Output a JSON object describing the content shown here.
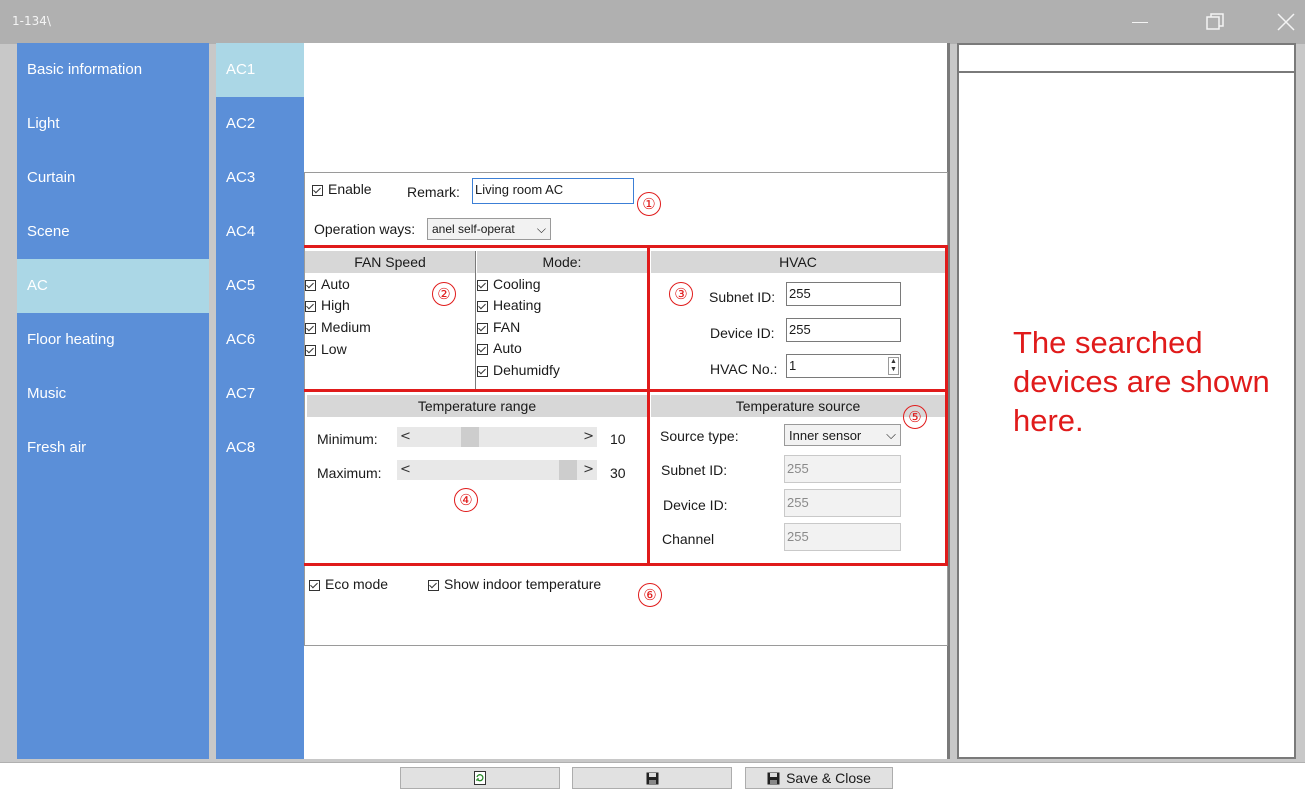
{
  "window": {
    "title": "1-134\\"
  },
  "sidebar": {
    "items": [
      {
        "label": "Basic information"
      },
      {
        "label": "Light"
      },
      {
        "label": "Curtain"
      },
      {
        "label": "Scene"
      },
      {
        "label": "AC",
        "active": true
      },
      {
        "label": "Floor heating"
      },
      {
        "label": "Music"
      },
      {
        "label": "Fresh air"
      }
    ]
  },
  "ac_tabs": [
    "AC1",
    "AC2",
    "AC3",
    "AC4",
    "AC5",
    "AC6",
    "AC7",
    "AC8"
  ],
  "general": {
    "enable_label": "Enable",
    "remark_label": "Remark:",
    "remark_value": "Living room AC",
    "operation_label": "Operation ways:",
    "operation_value": "anel self-operat"
  },
  "fan_speed": {
    "header": "FAN Speed",
    "options": [
      "Auto",
      "High",
      "Medium",
      "Low"
    ]
  },
  "mode": {
    "header": "Mode:",
    "options": [
      "Cooling",
      "Heating",
      "FAN",
      "Auto",
      "Dehumidfy"
    ]
  },
  "hvac": {
    "header": "HVAC",
    "subnet_label": "Subnet ID:",
    "subnet_value": "255",
    "device_label": "Device ID:",
    "device_value": "255",
    "no_label": "HVAC No.:",
    "no_value": "1"
  },
  "temp_range": {
    "header": "Temperature range",
    "min_label": "Minimum:",
    "min_value": "10",
    "min_arrow_left": "<",
    "min_arrow_right": ">",
    "max_label": "Maximum:",
    "max_value": "30",
    "max_arrow_left": "<",
    "max_arrow_right": ">"
  },
  "temp_source": {
    "header": "Temperature source",
    "source_type_label": "Source type:",
    "source_type_value": "Inner sensor",
    "subnet_label": "Subnet ID:",
    "subnet_value": "255",
    "device_label": "Device ID:",
    "device_value": "255",
    "channel_label": "Channel",
    "channel_value": "255"
  },
  "extras": {
    "eco_label": "Eco mode",
    "indoor_label": "Show indoor temperature"
  },
  "annotations": [
    "①",
    "②",
    "③",
    "④",
    "⑤",
    "⑥"
  ],
  "note": "The searched devices are shown here.",
  "footer": {
    "save_close_label": "Save & Close"
  },
  "colors": {
    "accent_red": "#e01b1b",
    "sidebar_blue": "#5b8fd8",
    "active_tab": "#abd7e6"
  }
}
